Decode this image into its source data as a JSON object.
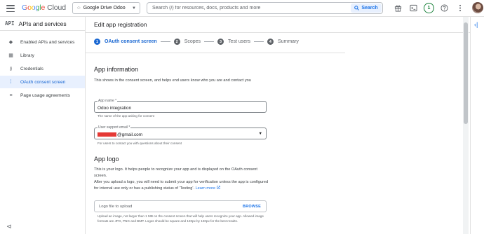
{
  "topbar": {
    "logo_google": "Google",
    "logo_cloud": "Cloud",
    "project_name": "Google Drive Odoo",
    "search_placeholder": "Search (/) for resources, docs, products and more",
    "search_button": "Search",
    "notification_count": "1",
    "icons": [
      "menu-icon",
      "project-icon",
      "search-icon",
      "gift-icon",
      "terminal-icon",
      "help-icon",
      "more-vert-icon"
    ]
  },
  "sidebar": {
    "api_badge": "API",
    "title": "APIs and services",
    "items": [
      {
        "label": "Enabled APIs and services",
        "icon": "◆"
      },
      {
        "label": "Library",
        "icon": "▦"
      },
      {
        "label": "Credentials",
        "icon": "⚷"
      },
      {
        "label": "OAuth consent screen",
        "icon": "⁞",
        "active": true
      },
      {
        "label": "Page usage agreements",
        "icon": "≡"
      }
    ],
    "collapse_icon": "⊲"
  },
  "main": {
    "title": "Edit app registration",
    "steps": [
      {
        "num": "1",
        "label": "OAuth consent screen",
        "current": true
      },
      {
        "num": "2",
        "label": "Scopes"
      },
      {
        "num": "3",
        "label": "Test users"
      },
      {
        "num": "4",
        "label": "Summary"
      }
    ],
    "app_info": {
      "title": "App information",
      "description": "This shows in the consent screen, and helps end users know who you are and contact you",
      "app_name_label": "App name *",
      "app_name_value": "Odoo integration",
      "app_name_hint": "The name of the app asking for consent",
      "email_label": "User support email *",
      "email_value": "@gmail.com",
      "email_hint": "For users to contact you with questions about their consent"
    },
    "app_logo": {
      "title": "App logo",
      "description": "This is your logo. It helps people to recognize your app and is displayed on the OAuth consent screen.",
      "verification_text": "After you upload a logo, you will need to submit your app for verification unless the app is configured for internal use only or has a publishing status of 'Testing'.",
      "learn_more": "Learn more",
      "upload_placeholder": "Logo file to upload",
      "browse_label": "BROWSE",
      "upload_hint": "Upload an image, not larger than 1 MB on the consent screen that will help users recognize your app. Allowed image formats are JPG, PNG and BMP. Logos should be square and 120px by 120px for the best results."
    }
  },
  "colors": {
    "primary": "#1a73e8",
    "active_bg": "#e8f0fe",
    "badge_green": "#188038",
    "redaction": "#e53935"
  }
}
